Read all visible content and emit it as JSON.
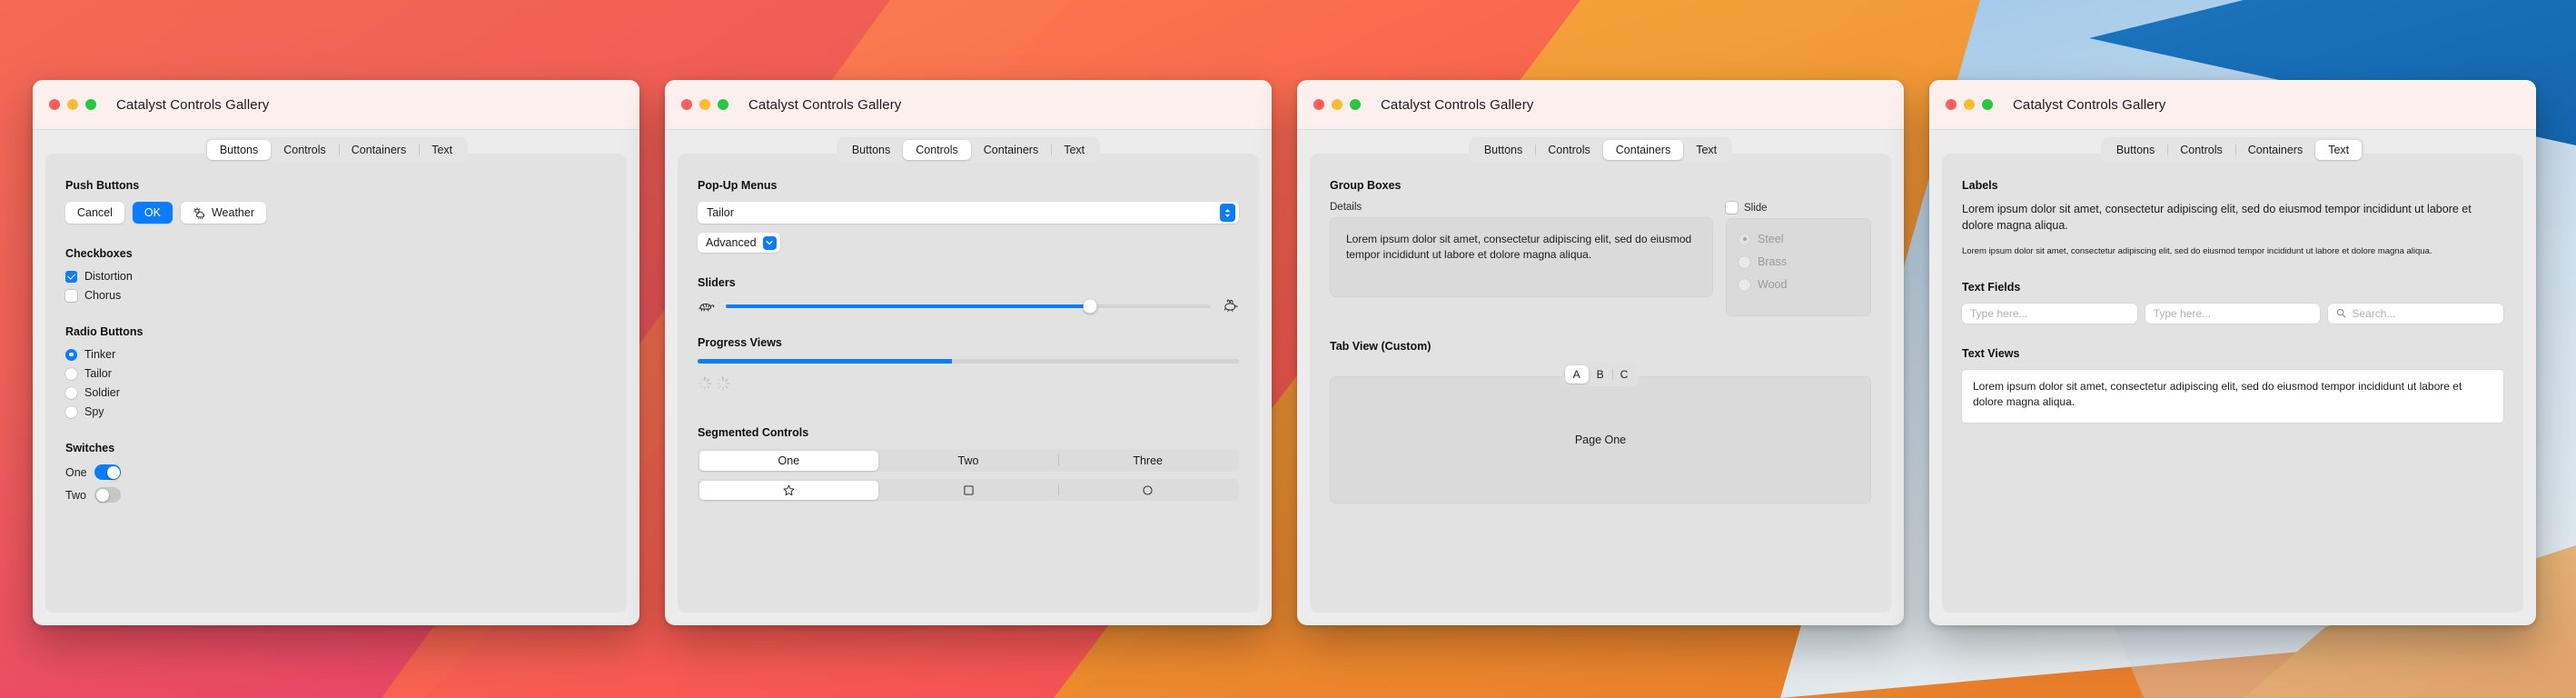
{
  "desktop": {
    "wallpaper_colors": {
      "red": "#e8334c",
      "magenta": "#d81b74",
      "pink": "#f0455f",
      "coral": "#fa6b55",
      "orange": "#f0922e",
      "light_blue": "#bedcf2",
      "blue": "#1a78c2",
      "pale_blue": "#d7e8f4"
    }
  },
  "window_common": {
    "title": "Catalyst Controls Gallery",
    "traffic_lights": [
      "close-button",
      "minimize-button",
      "zoom-button"
    ],
    "tabs": [
      "Buttons",
      "Controls",
      "Containers",
      "Text"
    ]
  },
  "windows": [
    {
      "active_tab": "Buttons",
      "sections": {
        "push_buttons": {
          "title": "Push Buttons",
          "buttons": [
            {
              "label": "Cancel",
              "style": "default"
            },
            {
              "label": "OK",
              "style": "primary"
            },
            {
              "label": "Weather",
              "style": "default",
              "icon": "sun-cloud-icon"
            }
          ]
        },
        "checkboxes": {
          "title": "Checkboxes",
          "items": [
            {
              "label": "Distortion",
              "checked": true
            },
            {
              "label": "Chorus",
              "checked": false
            }
          ]
        },
        "radio_buttons": {
          "title": "Radio Buttons",
          "items": [
            {
              "label": "Tinker",
              "selected": true
            },
            {
              "label": "Tailor",
              "selected": false
            },
            {
              "label": "Soldier",
              "selected": false
            },
            {
              "label": "Spy",
              "selected": false
            }
          ]
        },
        "switches": {
          "title": "Switches",
          "items": [
            {
              "label": "One",
              "on": true
            },
            {
              "label": "Two",
              "on": false
            }
          ]
        }
      }
    },
    {
      "active_tab": "Controls",
      "sections": {
        "popup_menus": {
          "title": "Pop-Up Menus",
          "wide_value": "Tailor",
          "small_value": "Advanced"
        },
        "sliders": {
          "title": "Sliders",
          "value_percent": 75,
          "min_icon": "tortoise-icon",
          "max_icon": "hare-icon"
        },
        "progress_views": {
          "title": "Progress Views",
          "bar_percent": 47,
          "spinners": 2
        },
        "segmented_controls": {
          "title": "Segmented Controls",
          "text_row": {
            "segments": [
              "One",
              "Two",
              "Three"
            ],
            "selected_index": 0
          },
          "icon_row": {
            "segments": [
              "star-icon",
              "square-icon",
              "circle-icon"
            ],
            "selected_index": 0
          }
        }
      }
    },
    {
      "active_tab": "Containers",
      "sections": {
        "group_boxes": {
          "title": "Group Boxes",
          "details_label": "Details",
          "details_text": "Lorem ipsum dolor sit amet, consectetur adipiscing elit, sed do eiusmod tempor incididunt ut labore et dolore magna aliqua.",
          "slide_label": "Slide",
          "slide_checked": false,
          "material_options": [
            {
              "label": "Steel",
              "selected": true,
              "disabled": true
            },
            {
              "label": "Brass",
              "selected": false,
              "disabled": true
            },
            {
              "label": "Wood",
              "selected": false,
              "disabled": true
            }
          ]
        },
        "tab_view": {
          "title": "Tab View (Custom)",
          "tabs": [
            "A",
            "B",
            "C"
          ],
          "selected_index": 0,
          "page_text": "Page One"
        }
      }
    },
    {
      "active_tab": "Text",
      "sections": {
        "labels": {
          "title": "Labels",
          "large_text": "Lorem ipsum dolor sit amet, consectetur adipiscing elit, sed do eiusmod tempor incididunt ut labore et dolore magna aliqua.",
          "small_text": "Lorem ipsum dolor sit amet, consectetur adipiscing elit, sed do eiusmod tempor incididunt ut labore et dolore magna aliqua."
        },
        "text_fields": {
          "title": "Text Fields",
          "field_one_placeholder": "Type here...",
          "field_two_placeholder": "Type here...",
          "search_placeholder": "Search...",
          "search_icon": "magnifier-icon"
        },
        "text_views": {
          "title": "Text Views",
          "value": "Lorem ipsum dolor sit amet, consectetur adipiscing elit, sed do eiusmod tempor incididunt ut labore et dolore magna aliqua."
        }
      }
    }
  ]
}
